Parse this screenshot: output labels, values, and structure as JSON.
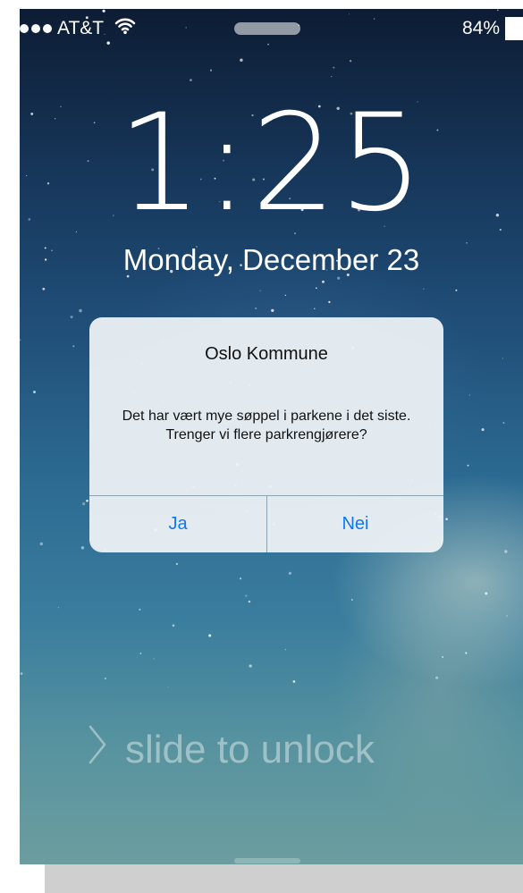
{
  "status_bar": {
    "carrier": "AT&T",
    "battery": "84%",
    "signal_icon": "signal-dots-icon",
    "wifi_icon": "wifi-icon",
    "battery_icon": "battery-icon"
  },
  "lock_screen": {
    "time": "1:25",
    "date": "Monday, December 23",
    "slide_label": "slide to unlock",
    "slide_icon": "chevron-right-icon"
  },
  "alert": {
    "title": "Oslo Kommune",
    "message": "Det har vært mye søppel i parkene i det siste. Trenger vi flere parkrengjørere?",
    "buttons": [
      {
        "label": "Ja"
      },
      {
        "label": "Nei"
      }
    ]
  },
  "colors": {
    "accent": "#1277ee",
    "alert_background": "#eef2f5",
    "sky_top": "#0d1c33",
    "sky_bottom": "#6c9d9f"
  }
}
